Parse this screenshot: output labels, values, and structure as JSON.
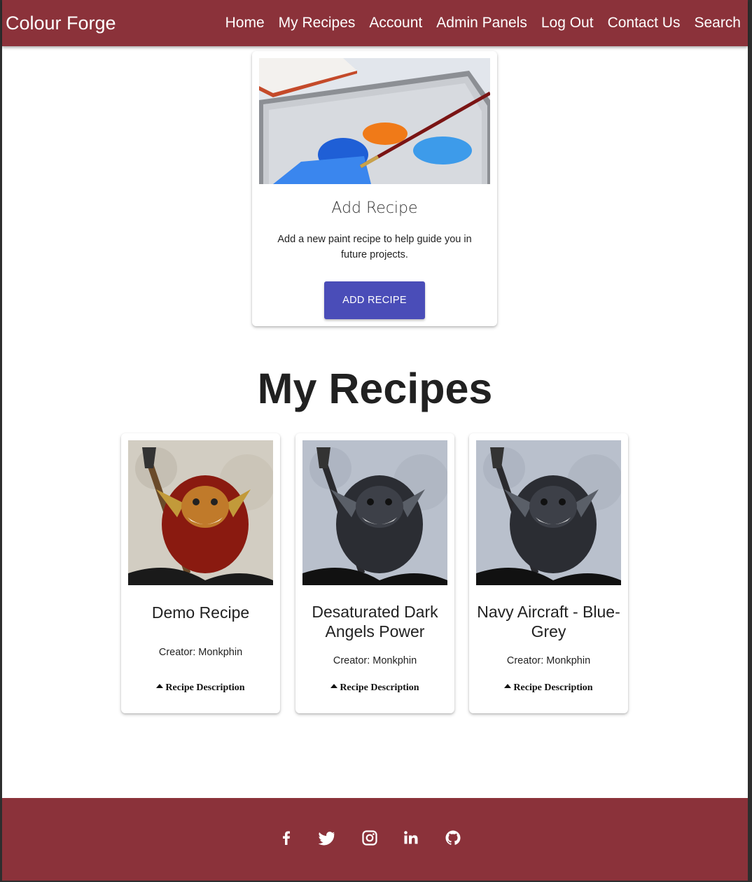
{
  "brand": "Colour Forge",
  "nav": [
    "Home",
    "My Recipes",
    "Account",
    "Admin Panels",
    "Log Out",
    "Contact Us",
    "Search"
  ],
  "add_card": {
    "title": "Add Recipe",
    "description": "Add a new paint recipe to help guide you in future projects.",
    "button": "ADD RECIPE"
  },
  "section_title": "My Recipes",
  "recipes": [
    {
      "title": "Demo Recipe",
      "creator": "Creator: Monkphin",
      "description_toggle": "Recipe Description"
    },
    {
      "title": "Desaturated Dark Angels Power",
      "creator": "Creator: Monkphin",
      "description_toggle": "Recipe Description"
    },
    {
      "title": "Navy Aircraft - Blue-Grey",
      "creator": "Creator: Monkphin",
      "description_toggle": "Recipe Description"
    }
  ],
  "footer": {
    "social_icons": [
      "facebook-icon",
      "twitter-icon",
      "instagram-icon",
      "linkedin-icon",
      "github-icon"
    ]
  },
  "colors": {
    "brand": "#8b323a",
    "button": "#4a4db8"
  }
}
